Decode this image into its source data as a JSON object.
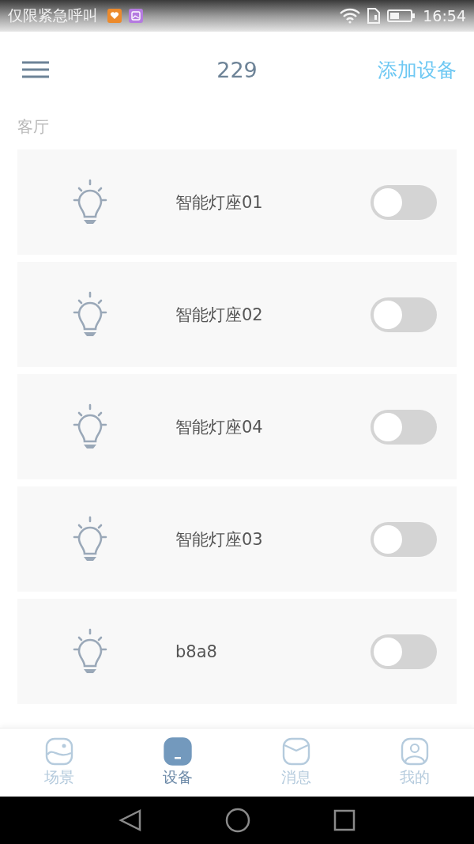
{
  "status_bar": {
    "carrier": "仅限紧急呼叫",
    "time": "16:54"
  },
  "header": {
    "title": "229",
    "action": "添加设备"
  },
  "section": {
    "title": "客厅"
  },
  "devices": [
    {
      "name": "智能灯座01",
      "on": false
    },
    {
      "name": "智能灯座02",
      "on": false
    },
    {
      "name": "智能灯座04",
      "on": false
    },
    {
      "name": "智能灯座03",
      "on": false
    },
    {
      "name": "b8a8",
      "on": false
    }
  ],
  "tabs": [
    {
      "label": "场景",
      "kind": "scene",
      "selected": false
    },
    {
      "label": "设备",
      "kind": "device",
      "selected": true
    },
    {
      "label": "消息",
      "kind": "message",
      "selected": false
    },
    {
      "label": "我的",
      "kind": "profile",
      "selected": false
    }
  ]
}
